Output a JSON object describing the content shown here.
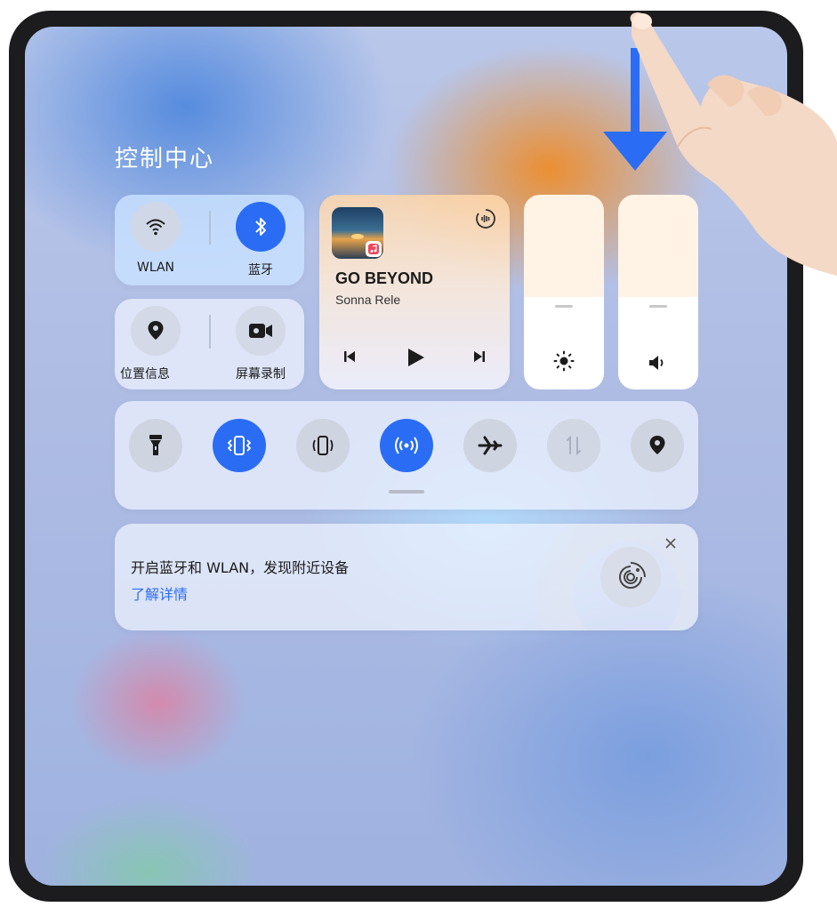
{
  "control_center": {
    "title": "控制中心"
  },
  "connectivity": {
    "wlan_label": "WLAN",
    "bluetooth_label": "蓝牙",
    "location_label": "位置信息",
    "screen_record_label": "屏幕录制"
  },
  "media": {
    "song_title": "GO BEYOND",
    "artist": "Sonna Rele"
  },
  "sliders": {
    "brightness_level": 0.5,
    "volume_level": 0.5
  },
  "quick_toggles": [
    {
      "name": "flashlight",
      "state": "off"
    },
    {
      "name": "vibrate",
      "state": "on"
    },
    {
      "name": "vibration-mode",
      "state": "off"
    },
    {
      "name": "hotspot",
      "state": "on"
    },
    {
      "name": "airplane-mode",
      "state": "off"
    },
    {
      "name": "mobile-data",
      "state": "disabled"
    },
    {
      "name": "location",
      "state": "off"
    }
  ],
  "notice": {
    "message": "开启蓝牙和 WLAN，发现附近设备",
    "link": "了解详情"
  },
  "colors": {
    "accent": "#2a6df4",
    "arrow": "#2a6df4"
  }
}
